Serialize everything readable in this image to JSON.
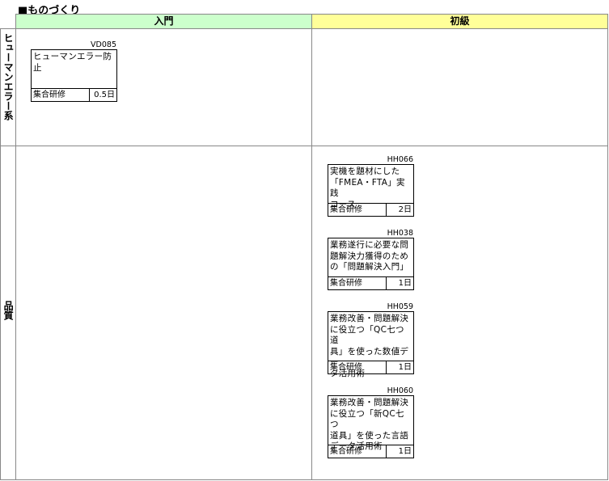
{
  "page": {
    "title": "■ものづくり"
  },
  "columns": {
    "col1": "入門",
    "col2": "初級"
  },
  "rows": {
    "row1": "ヒューマンエラー系",
    "row2": "品質"
  },
  "courses": [
    {
      "code": "VD085",
      "title": "ヒューマンエラー防止",
      "type": "集合研修",
      "duration": "0.5日"
    },
    {
      "code": "HH066",
      "title": "実機を題材にした\n「FMEA・FTA」実践\nコース",
      "type": "集合研修",
      "duration": "2日"
    },
    {
      "code": "HH038",
      "title": "業務遂行に必要な問\n題解決力獲得のため\nの「問題解決入門」",
      "type": "集合研修",
      "duration": "1日"
    },
    {
      "code": "HH059",
      "title": "業務改善・問題解決\nに役立つ「QC七つ道\n具」を使った数値デー\nタ活用術",
      "type": "集合研修",
      "duration": "1日"
    },
    {
      "code": "HH060",
      "title": "業務改善・問題解決\nに役立つ「新QC七つ\n道具」を使った言語\nデータ活用術",
      "type": "集合研修",
      "duration": "1日"
    }
  ],
  "colors": {
    "col1_header": "#ccffcc",
    "col2_header": "#ffff99",
    "grid_line": "#888888"
  }
}
